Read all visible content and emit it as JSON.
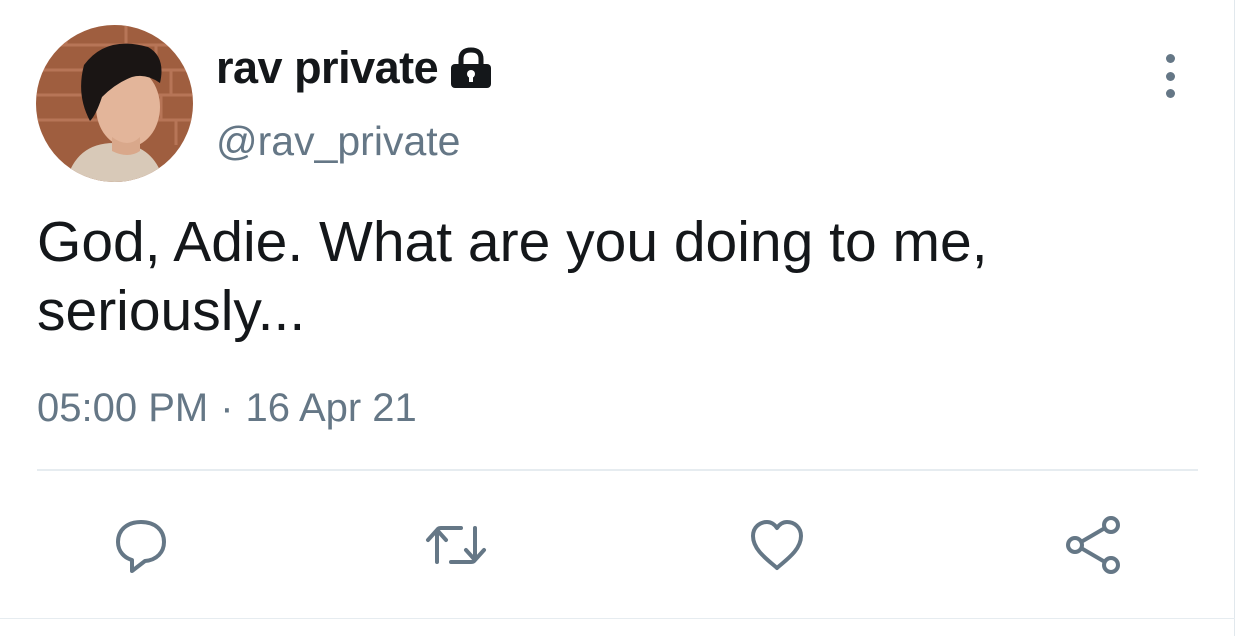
{
  "user": {
    "display_name": "rav private",
    "handle": "@rav_private",
    "protected_icon": "lock-icon",
    "avatar_icon": "profile-photo"
  },
  "tweet": {
    "text": "God, Adie. What are you doing to me, seriously...",
    "time": "05:00 PM",
    "separator": "·",
    "date": "16 Apr 21"
  },
  "actions": [
    {
      "icon": "reply-icon"
    },
    {
      "icon": "retweet-icon"
    },
    {
      "icon": "like-icon"
    },
    {
      "icon": "share-icon"
    }
  ],
  "menu": {
    "icon": "more-vertical-icon"
  },
  "colors": {
    "text_primary": "#14171a",
    "text_secondary": "#657786",
    "icon": "#657786",
    "divider": "#e6ecf0",
    "background": "#ffffff"
  }
}
